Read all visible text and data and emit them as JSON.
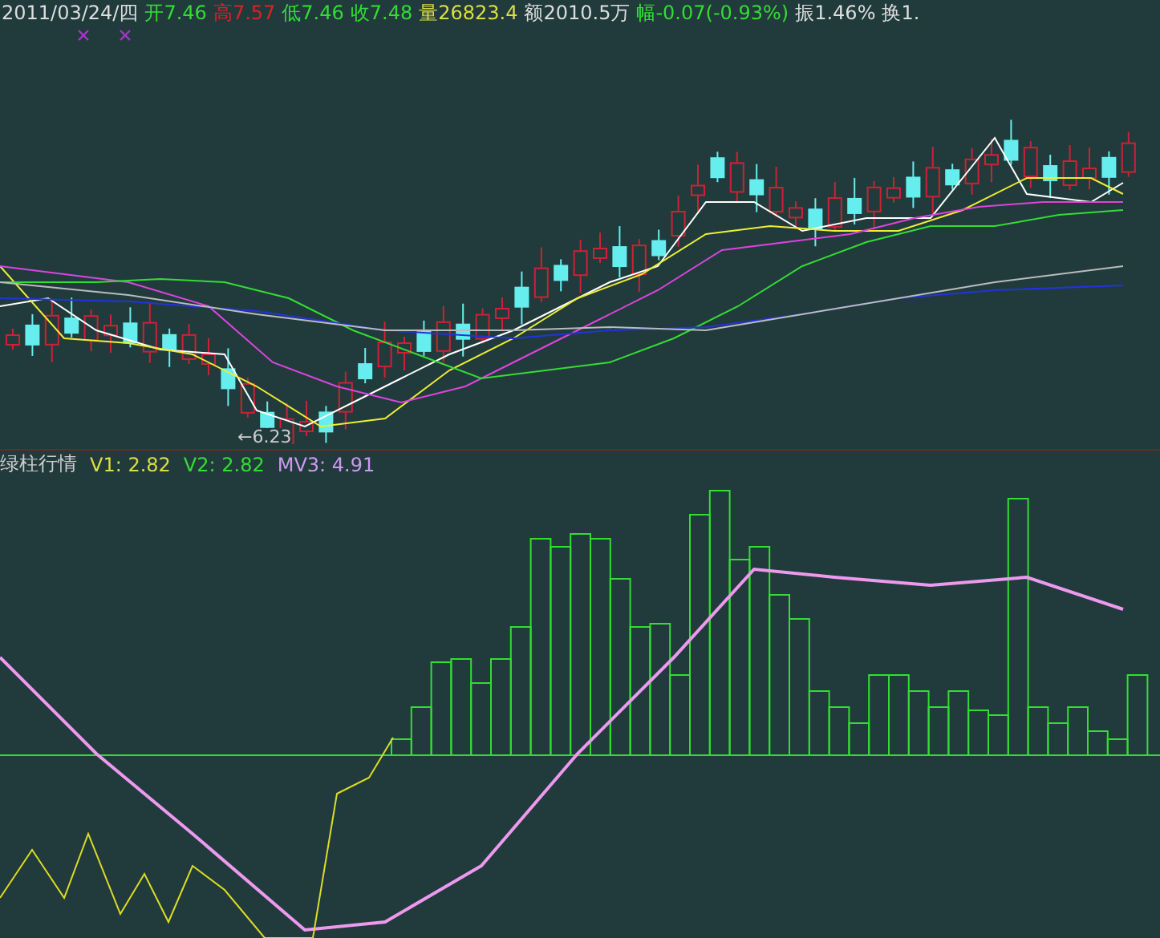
{
  "quote_bar": {
    "date": "2011/03/24/四",
    "fields": [
      {
        "text": "开7.46",
        "color": "#33dd33"
      },
      {
        "text": "高7.57",
        "color": "#dd2222"
      },
      {
        "text": "低7.46",
        "color": "#33dd33"
      },
      {
        "text": "收7.48",
        "color": "#33dd33"
      },
      {
        "text": "量26823.4",
        "color": "#dddd44"
      },
      {
        "text": "额2010.5万",
        "color": "#dddddd"
      },
      {
        "text": "幅-0.07(-0.93%)",
        "color": "#33dd33"
      },
      {
        "text": "振1.46%",
        "color": "#dddddd"
      },
      {
        "text": "换1.",
        "color": "#dddddd"
      }
    ]
  },
  "price_chart": {
    "low_marker": "←6.23"
  },
  "indicator": {
    "name": "绿柱行情",
    "values": [
      {
        "text": "V1: 2.82",
        "color": "#dddd44"
      },
      {
        "text": "V2: 2.82",
        "color": "#33dd33"
      },
      {
        "text": "MV3: 4.91",
        "color": "#cc99ee"
      }
    ]
  }
}
